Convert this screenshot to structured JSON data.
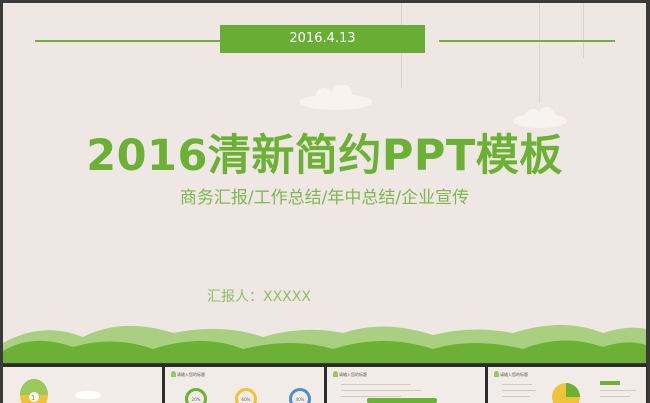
{
  "slide": {
    "date": "2016.4.13",
    "title": "2016清新简约PPT模板",
    "subtitle": "商务汇报/工作总结/年中总结/企业宣传",
    "reporter": "汇报人：XXXXX"
  },
  "thumbnails": [
    {
      "label": "1"
    },
    {
      "heading": "请输入您的标题",
      "rings": [
        "20%",
        "60%",
        "40%"
      ]
    },
    {
      "heading": "请输入您的标题"
    },
    {
      "heading": "请输入您的标题"
    }
  ],
  "colors": {
    "accent": "#6bb133",
    "background": "#efe7e3",
    "frame": "#3a3a3a"
  }
}
